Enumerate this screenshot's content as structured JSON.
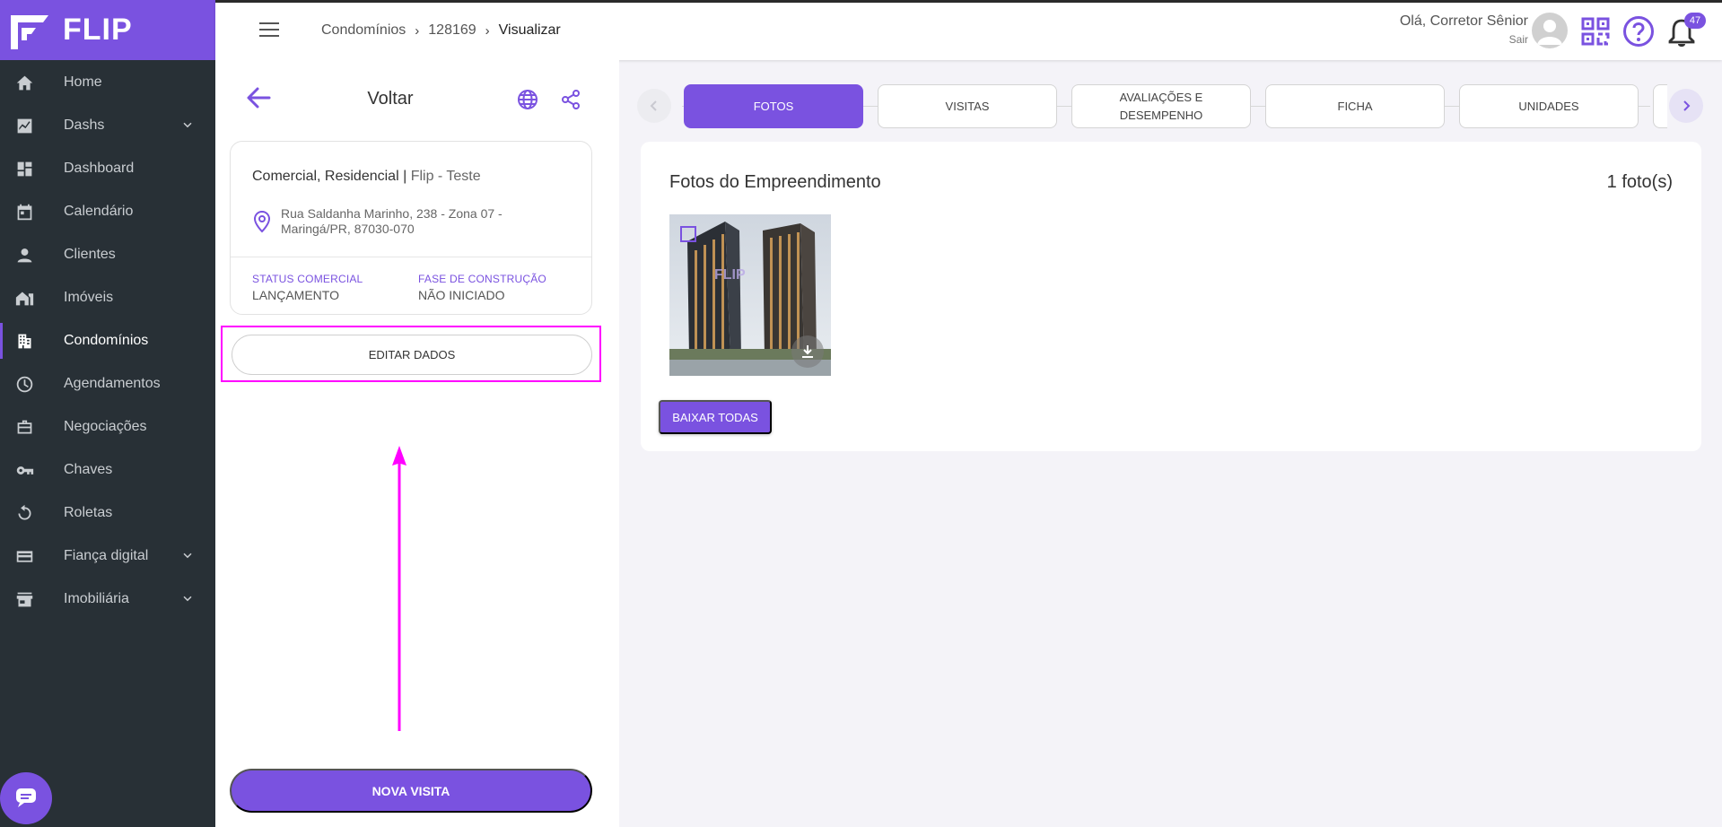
{
  "brand": {
    "name": "FLIP"
  },
  "nav": [
    {
      "label": "Home",
      "icon": "home-icon"
    },
    {
      "label": "Dashs",
      "icon": "chart-icon",
      "expandable": true
    },
    {
      "label": "Dashboard",
      "icon": "dashboard-icon"
    },
    {
      "label": "Calendário",
      "icon": "calendar-icon"
    },
    {
      "label": "Clientes",
      "icon": "person-icon"
    },
    {
      "label": "Imóveis",
      "icon": "house-icon"
    },
    {
      "label": "Condomínios",
      "icon": "building-icon",
      "active": true
    },
    {
      "label": "Agendamentos",
      "icon": "clock-icon"
    },
    {
      "label": "Negociações",
      "icon": "briefcase-icon"
    },
    {
      "label": "Chaves",
      "icon": "key-icon"
    },
    {
      "label": "Roletas",
      "icon": "rotate-icon"
    },
    {
      "label": "Fiança digital",
      "icon": "card-icon",
      "expandable": true
    },
    {
      "label": "Imobiliária",
      "icon": "store-icon",
      "expandable": true
    }
  ],
  "header": {
    "breadcrumb": [
      "Condomínios",
      "128169",
      "Visualizar"
    ],
    "greeting": "Olá, Corretor Sênior",
    "logout": "Sair",
    "notifications": "47"
  },
  "panel": {
    "back_label": "Voltar",
    "types": "Comercial, Residencial",
    "type_sep": "|",
    "company": "Flip - Teste",
    "address_line1": "Rua Saldanha Marinho, 238 - Zona 07 -",
    "address_line2": "Maringá/PR, 87030-070",
    "status_label": "STATUS COMERCIAL",
    "status_value": "LANÇAMENTO",
    "phase_label": "FASE DE CONSTRUÇÃO",
    "phase_value": "NÃO INICIADO",
    "edit_button": "EDITAR DADOS",
    "visit_button": "NOVA VISITA"
  },
  "tabs": [
    {
      "label": "FOTOS",
      "active": true
    },
    {
      "label": "VISITAS"
    },
    {
      "label": "AVALIAÇÕES E DESEMPENHO"
    },
    {
      "label": "FICHA"
    },
    {
      "label": "UNIDADES"
    }
  ],
  "photos": {
    "title": "Fotos do Empreendimento",
    "count": "1 foto(s)",
    "watermark": "FLIP",
    "download_all": "BAIXAR TODAS"
  },
  "colors": {
    "accent": "#7a52e0",
    "sidebar": "#283036",
    "highlight": "#ff00ff"
  }
}
